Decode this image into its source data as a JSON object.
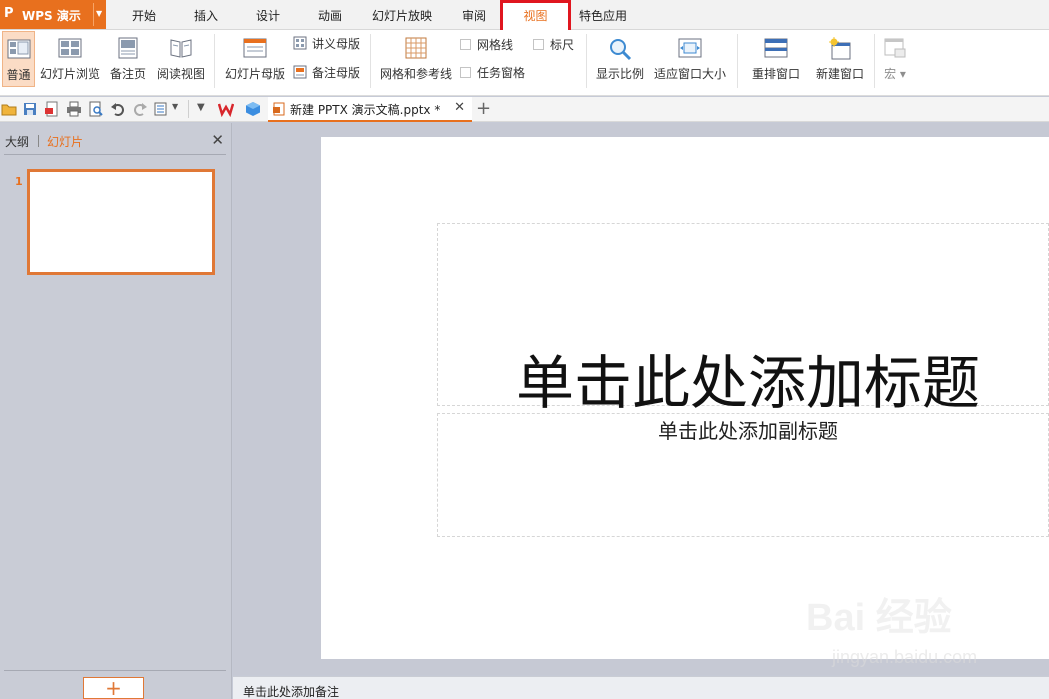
{
  "app": {
    "logo": "P",
    "name": "WPS 演示"
  },
  "menu_tabs": [
    {
      "label": "开始"
    },
    {
      "label": "插入"
    },
    {
      "label": "设计"
    },
    {
      "label": "动画"
    },
    {
      "label": "幻灯片放映"
    },
    {
      "label": "审阅"
    },
    {
      "label": "视图",
      "active": true
    },
    {
      "label": "特色应用"
    }
  ],
  "ribbon": {
    "normal": "普通",
    "slide_sorter": "幻灯片浏览",
    "notes_page": "备注页",
    "reading_view": "阅读视图",
    "slide_master": "幻灯片母版",
    "handout_master": "讲义母版",
    "notes_master": "备注母版",
    "grid_guides": "网格和参考线",
    "gridlines": "网格线",
    "ruler": "标尺",
    "task_pane": "任务窗格",
    "zoom": "显示比例",
    "fit_window": "适应窗口大小",
    "arrange_windows": "重排窗口",
    "new_window": "新建窗口",
    "macro": "宏"
  },
  "doc_tab": {
    "title": "新建 PPTX 演示文稿.pptx *"
  },
  "left_pane": {
    "outline_tab": "大纲",
    "slides_tab": "幻灯片",
    "slide_number": "1",
    "add_slide": "+"
  },
  "slide": {
    "title_placeholder": "单击此处添加标题",
    "subtitle_placeholder": "单击此处添加副标题"
  },
  "notes": {
    "placeholder": "单击此处添加备注"
  },
  "watermark": {
    "logo": "Bai 经验",
    "url": "jingyan.baidu.com"
  },
  "colors": {
    "accent": "#e8701e",
    "highlight_box": "#e0161f"
  }
}
